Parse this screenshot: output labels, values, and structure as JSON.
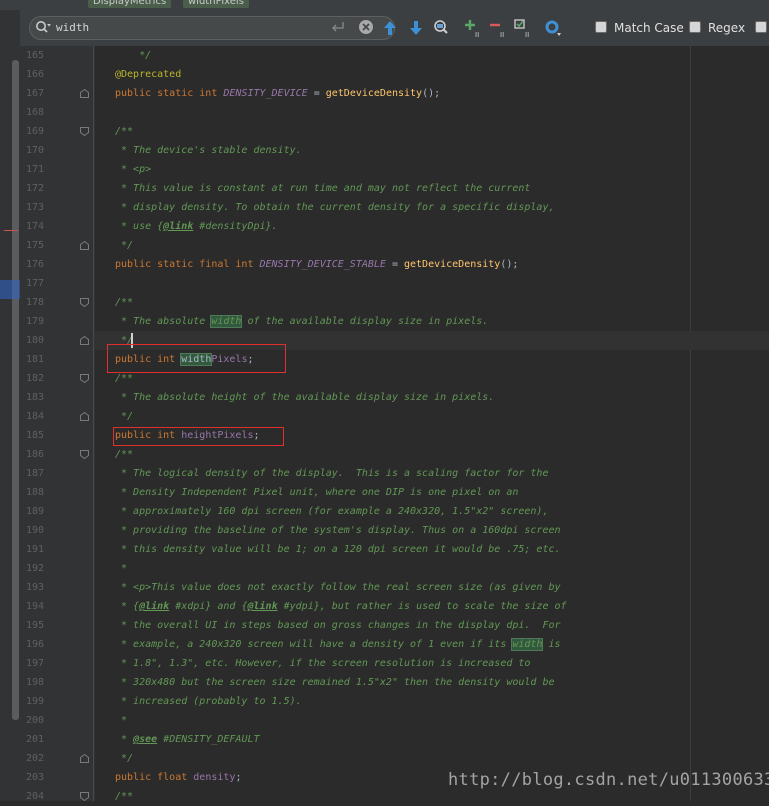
{
  "breadcrumbs": [
    "DisplayMetrics",
    "widthPixels"
  ],
  "search": {
    "value": "width",
    "options": [
      {
        "label": "Match Case",
        "checked": false
      },
      {
        "label": "Regex",
        "checked": false
      }
    ]
  },
  "toolbar": {
    "icons": [
      "previous-occurrence-icon",
      "next-occurrence-icon",
      "find-all-icon",
      "add-selection-icon",
      "remove-selection-icon",
      "select-all-occurrences-icon",
      "filter-settings-icon"
    ]
  },
  "colors": {
    "keyword": "#cc7832",
    "comment": "#629755",
    "constant": "#9876aa",
    "method": "#ffc66d",
    "annotation": "#bbb529",
    "match_highlight": "#32593d",
    "red_box": "#e0302e"
  },
  "code": [
    {
      "n": "165",
      "segs": [
        [
          "cm",
          "    */"
        ]
      ]
    },
    {
      "n": "166",
      "segs": [
        [
          "an",
          "@Deprecated"
        ]
      ]
    },
    {
      "n": "167",
      "fold": "end",
      "segs": [
        [
          "kw",
          "public static int "
        ],
        [
          "cn",
          "DENSITY_DEVICE"
        ],
        [
          "p",
          " = "
        ],
        [
          "fn",
          "getDeviceDensity"
        ],
        [
          "p",
          "();"
        ]
      ]
    },
    {
      "n": "168",
      "segs": []
    },
    {
      "n": "169",
      "fold": "start",
      "segs": [
        [
          "cm",
          "/**"
        ]
      ]
    },
    {
      "n": "170",
      "segs": [
        [
          "cm",
          " * The device's stable density."
        ]
      ]
    },
    {
      "n": "171",
      "segs": [
        [
          "cm",
          " * <p>"
        ]
      ]
    },
    {
      "n": "172",
      "segs": [
        [
          "cm",
          " * This value is constant at run time and may not reflect the current"
        ]
      ]
    },
    {
      "n": "173",
      "segs": [
        [
          "cm",
          " * display density. To obtain the current density for a specific display,"
        ]
      ]
    },
    {
      "n": "174",
      "segs": [
        [
          "cm",
          " * use {"
        ],
        [
          "tg",
          "@link"
        ],
        [
          "cm",
          " #densityDpi}."
        ]
      ]
    },
    {
      "n": "175",
      "fold": "end",
      "segs": [
        [
          "cm",
          " */"
        ]
      ]
    },
    {
      "n": "176",
      "segs": [
        [
          "kw",
          "public static final int "
        ],
        [
          "cn",
          "DENSITY_DEVICE_STABLE"
        ],
        [
          "p",
          " = "
        ],
        [
          "fn",
          "getDeviceDensity"
        ],
        [
          "p",
          "();"
        ]
      ]
    },
    {
      "n": "177",
      "segs": []
    },
    {
      "n": "178",
      "fold": "start",
      "segs": [
        [
          "cm",
          "/**"
        ]
      ]
    },
    {
      "n": "179",
      "segs": [
        [
          "cm",
          " * The absolute "
        ],
        [
          "hitc",
          "width"
        ],
        [
          "cm",
          " of the available display size in pixels."
        ]
      ]
    },
    {
      "n": "180",
      "fold": "end",
      "segs": [
        [
          "cm",
          " */"
        ]
      ]
    },
    {
      "n": "181",
      "segs": [
        [
          "kw",
          "public int "
        ],
        [
          "hit",
          "width"
        ],
        [
          "field",
          "Pixels"
        ],
        [
          "p",
          ";"
        ]
      ]
    },
    {
      "n": "182",
      "fold": "start",
      "segs": [
        [
          "cm",
          "/**"
        ]
      ]
    },
    {
      "n": "183",
      "segs": [
        [
          "cm",
          " * The absolute height of the available display size in pixels."
        ]
      ]
    },
    {
      "n": "184",
      "fold": "end",
      "segs": [
        [
          "cm",
          " */"
        ]
      ]
    },
    {
      "n": "185",
      "segs": [
        [
          "kw",
          "public int "
        ],
        [
          "field",
          "heightPixels"
        ],
        [
          "p",
          ";"
        ]
      ]
    },
    {
      "n": "186",
      "fold": "start",
      "segs": [
        [
          "cm",
          "/**"
        ]
      ]
    },
    {
      "n": "187",
      "segs": [
        [
          "cm",
          " * The logical density of the display.  This is a scaling factor for the"
        ]
      ]
    },
    {
      "n": "188",
      "segs": [
        [
          "cm",
          " * Density Independent Pixel unit, where one DIP is one pixel on an"
        ]
      ]
    },
    {
      "n": "189",
      "segs": [
        [
          "cm",
          " * approximately 160 dpi screen (for example a 240x320, 1.5\"x2\" screen),"
        ]
      ]
    },
    {
      "n": "190",
      "segs": [
        [
          "cm",
          " * providing the baseline of the system's display. Thus on a 160dpi screen"
        ]
      ]
    },
    {
      "n": "191",
      "segs": [
        [
          "cm",
          " * this density value will be 1; on a 120 dpi screen it would be .75; etc."
        ]
      ]
    },
    {
      "n": "192",
      "segs": [
        [
          "cm",
          " *"
        ]
      ]
    },
    {
      "n": "193",
      "segs": [
        [
          "cm",
          " * <p>This value does not exactly follow the real screen size (as given by"
        ]
      ]
    },
    {
      "n": "194",
      "segs": [
        [
          "cm",
          " * {"
        ],
        [
          "tg",
          "@link"
        ],
        [
          "cm",
          " #xdpi} and {"
        ],
        [
          "tg",
          "@link"
        ],
        [
          "cm",
          " #ydpi}, but rather is used to scale the size of"
        ]
      ]
    },
    {
      "n": "195",
      "segs": [
        [
          "cm",
          " * the overall UI in steps based on gross changes in the display dpi.  For"
        ]
      ]
    },
    {
      "n": "196",
      "segs": [
        [
          "cm",
          " * example, a 240x320 screen will have a density of 1 even if its "
        ],
        [
          "hitc",
          "width"
        ],
        [
          "cm",
          " is"
        ]
      ]
    },
    {
      "n": "197",
      "segs": [
        [
          "cm",
          " * 1.8\", 1.3\", etc. However, if the screen resolution is increased to"
        ]
      ]
    },
    {
      "n": "198",
      "segs": [
        [
          "cm",
          " * 320x480 but the screen size remained 1.5\"x2\" then the density would be"
        ]
      ]
    },
    {
      "n": "199",
      "segs": [
        [
          "cm",
          " * increased (probably to 1.5)."
        ]
      ]
    },
    {
      "n": "200",
      "segs": [
        [
          "cm",
          " *"
        ]
      ]
    },
    {
      "n": "201",
      "segs": [
        [
          "cm",
          " * "
        ],
        [
          "tg",
          "@see"
        ],
        [
          "cm",
          " #DENSITY_DEFAULT"
        ]
      ]
    },
    {
      "n": "202",
      "fold": "end",
      "segs": [
        [
          "cm",
          " */"
        ]
      ]
    },
    {
      "n": "203",
      "segs": [
        [
          "kw",
          "public float "
        ],
        [
          "field",
          "density"
        ],
        [
          "p",
          ";"
        ]
      ]
    },
    {
      "n": "204",
      "fold": "start",
      "segs": [
        [
          "cm",
          "/**"
        ]
      ]
    }
  ],
  "watermark": "http://blog.csdn.net/u011300633"
}
